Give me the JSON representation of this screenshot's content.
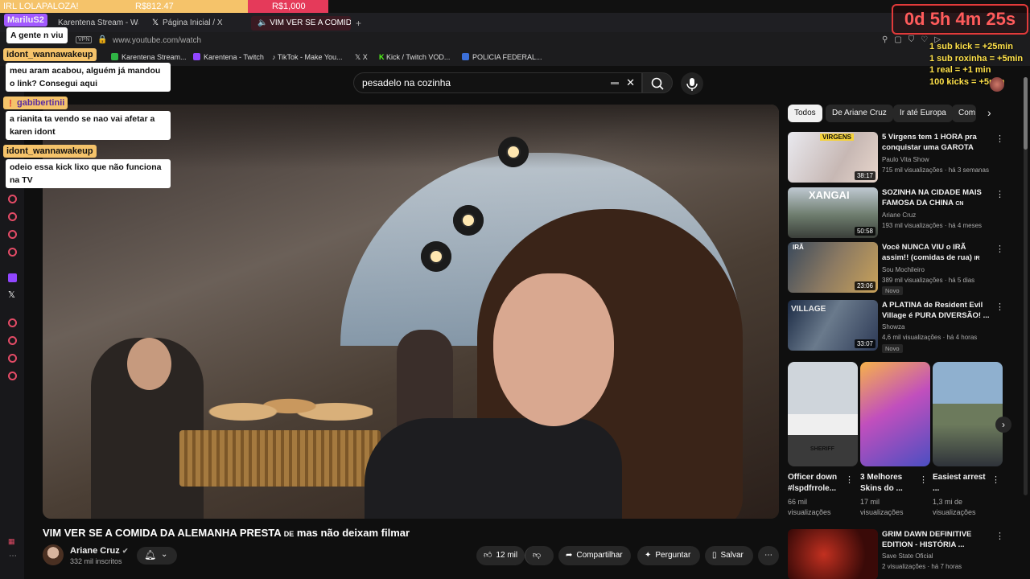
{
  "overlay_top": {
    "goal_label": "IRL LOLAPALOZA!",
    "goal_amount": "R$812.47",
    "goal_target": "R$1,000"
  },
  "browser": {
    "tabs": [
      {
        "label": "Karentena Stream - Watch"
      },
      {
        "label": "Página Inicial / X"
      },
      {
        "label": "VIM VER SE A COMIDA"
      }
    ],
    "vpn_badge": "VPN",
    "url": "www.youtube.com/watch",
    "bookmarks": [
      {
        "label": "Karentena Stream...",
        "color": "#2fb344"
      },
      {
        "label": "Karentena - Twitch",
        "color": "#9146ff"
      },
      {
        "label": "TikTok - Make You...",
        "color": "#ffffff"
      },
      {
        "label": "X",
        "color": "#ffffff"
      },
      {
        "label": "Kick / Twitch VOD...",
        "color": "#53fc18"
      },
      {
        "label": "POLICIA FEDERAL...",
        "color": "#3b6fd8"
      }
    ]
  },
  "youtube": {
    "search_value": "pesadelo na cozinha",
    "video_title_main": "VIM VER SE A COMIDA DA ALEMANHA PRESTA",
    "video_title_small": "DE",
    "video_title_tail": "mas não deixam filmar",
    "channel_name": "Ariane Cruz",
    "channel_subs": "332 mil inscritos",
    "likes": "12 mil",
    "share_label": "Compartilhar",
    "ask_label": "Perguntar",
    "save_label": "Salvar",
    "chips": [
      "Todos",
      "De Ariane Cruz",
      "Ir até Europa",
      "Com"
    ],
    "recommendations": [
      {
        "title": "5 Virgens tem 1 HORA pra conquistar uma GAROTA",
        "channel": "Paulo Vita Show",
        "meta": "715 mil visualizações · há 3 semanas",
        "duration": "38:17",
        "badge": "",
        "thumb_label": "VIRGENS"
      },
      {
        "title": "SOZINHA NA CIDADE MAIS FAMOSA DA CHINA",
        "title_suffix": "CN",
        "channel": "Ariane Cruz",
        "meta": "193 mil visualizações · há 4 meses",
        "duration": "50:58",
        "badge": "",
        "thumb_label": "XANGAI"
      },
      {
        "title": "Você NUNCA VIU o IRÃ assim!! (comidas de rua)",
        "title_suffix": "IR",
        "channel": "Sou Mochileiro",
        "meta": "389 mil visualizações · há 5 dias",
        "duration": "23:06",
        "badge": "Novo",
        "thumb_label": "IRÃ"
      },
      {
        "title": "A PLATINA de Resident Evil Village é PURA DIVERSÃO! ...",
        "channel": "Showza",
        "meta": "4,6 mil visualizações · há 4 horas",
        "duration": "33:07",
        "badge": "Novo",
        "thumb_label": "VILLAGE"
      }
    ],
    "shorts": [
      {
        "title": "Officer down #lspdfrrole...",
        "views": "66 mil visualizações",
        "thumb_label": "SHERIFF"
      },
      {
        "title": "3 Melhores Skins do ...",
        "views": "17 mil visualizações",
        "thumb_label": ""
      },
      {
        "title": "Easiest arrest ...",
        "views": "1,3 mi de visualizações",
        "thumb_label": ""
      }
    ],
    "bottom_rec": {
      "title": "GRIM DAWN DEFINITIVE EDITION - HISTÓRIA ...",
      "channel": "Save State Oficial",
      "meta": "2 visualizações · há 7 horas"
    }
  },
  "chat": [
    {
      "user": "MariluS2",
      "user_color": "#a259ff",
      "text_color": "#ffffff",
      "message": "A gente n viu"
    },
    {
      "user": "idont_wannawakeup",
      "user_color": "#f5c36a",
      "text_color": "#111111",
      "message": "meu aram acabou, alguém já mandou o link? Consegui aqui"
    },
    {
      "user": "gabibertinii",
      "user_color": "#f5c36a",
      "text_color": "#5a2ca0",
      "message": "a rianita ta vendo se nao vai afetar a karen idont"
    },
    {
      "user": "idont_wannawakeup",
      "user_color": "#f5c36a",
      "text_color": "#111111",
      "message": "odeio essa kick lixo que não funciona na TV"
    }
  ],
  "stream_overlay": {
    "timer": "0d 5h 4m 25s",
    "rules": [
      "1 sub kick = +25min",
      "1 sub roxinha = +5min",
      "1 real = +1 min",
      "100 kicks = +5min"
    ]
  },
  "colors": {
    "accent_red": "#e23a3a",
    "rule_yellow": "#ffe24a",
    "youtube_bg": "#0f0f0f"
  }
}
